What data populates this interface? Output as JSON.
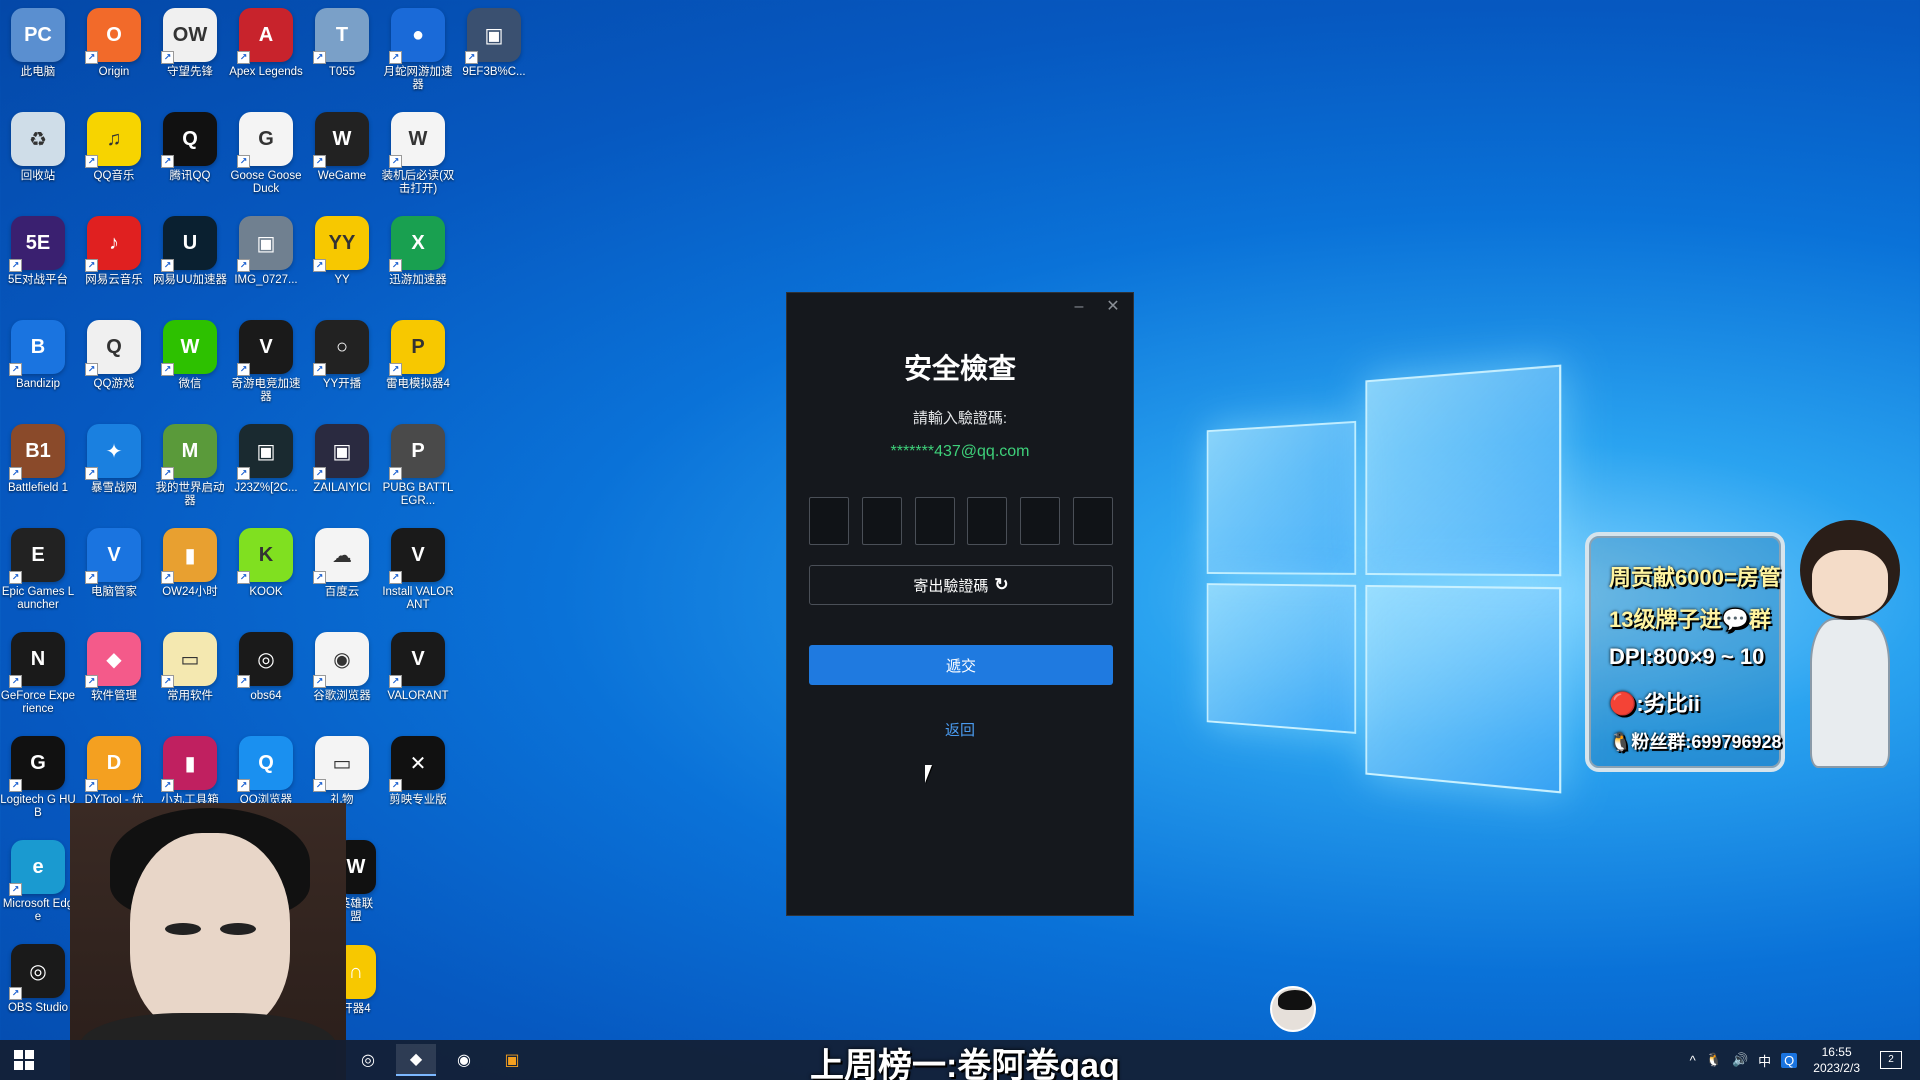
{
  "desktop": {
    "icons": [
      {
        "label": "此电脑",
        "color": "#5a8fd0",
        "glyph": "PC"
      },
      {
        "label": "Origin",
        "color": "#f26a2a",
        "glyph": "O"
      },
      {
        "label": "守望先锋",
        "color": "#f0f0f0",
        "glyph": "OW"
      },
      {
        "label": "Apex Legends",
        "color": "#c8232c",
        "glyph": "A"
      },
      {
        "label": "T055",
        "color": "#7aa0c8",
        "glyph": "T"
      },
      {
        "label": "月蛇网游加速器",
        "color": "#1a6ad8",
        "glyph": "●"
      },
      {
        "label": "9EF3B%C...",
        "color": "#3a5070",
        "glyph": "▣"
      },
      {
        "label": "回收站",
        "color": "#cfdde8",
        "glyph": "♻"
      },
      {
        "label": "QQ音乐",
        "color": "#f7d400",
        "glyph": "♫"
      },
      {
        "label": "腾讯QQ",
        "color": "#111111",
        "glyph": "Q"
      },
      {
        "label": "Goose Goose Duck",
        "color": "#f4f4f4",
        "glyph": "G"
      },
      {
        "label": "WeGame",
        "color": "#222222",
        "glyph": "W"
      },
      {
        "label": "装机后必读(双击打开)",
        "color": "#f4f4f4",
        "glyph": "W"
      },
      {
        "label": "5E对战平台",
        "color": "#3a2070",
        "glyph": "5E"
      },
      {
        "label": "网易云音乐",
        "color": "#e02020",
        "glyph": "♪"
      },
      {
        "label": "网易UU加速器",
        "color": "#0a2030",
        "glyph": "U"
      },
      {
        "label": "IMG_0727...",
        "color": "#708090",
        "glyph": "▣"
      },
      {
        "label": "YY",
        "color": "#f7c800",
        "glyph": "YY"
      },
      {
        "label": "迅游加速器",
        "color": "#19a050",
        "glyph": "X"
      },
      {
        "label": "Bandizip",
        "color": "#1a74e0",
        "glyph": "B"
      },
      {
        "label": "QQ游戏",
        "color": "#f0f0f0",
        "glyph": "Q"
      },
      {
        "label": "微信",
        "color": "#2dc100",
        "glyph": "W"
      },
      {
        "label": "奇游电竞加速器",
        "color": "#1a1a1a",
        "glyph": "V"
      },
      {
        "label": "YY开播",
        "color": "#222222",
        "glyph": "○"
      },
      {
        "label": "雷电模拟器4",
        "color": "#f7c800",
        "glyph": "P"
      },
      {
        "label": "Battlefield 1",
        "color": "#8a4a2a",
        "glyph": "B1"
      },
      {
        "label": "暴雪战网",
        "color": "#1a80e0",
        "glyph": "✦"
      },
      {
        "label": "我的世界启动器",
        "color": "#5a9a3a",
        "glyph": "M"
      },
      {
        "label": "J23Z%[2C...",
        "color": "#1a2a30",
        "glyph": "▣"
      },
      {
        "label": "ZAILAIYICI",
        "color": "#2a2a40",
        "glyph": "▣"
      },
      {
        "label": "PUBG BATTLEGR...",
        "color": "#4a4a4a",
        "glyph": "P"
      },
      {
        "label": "Epic Games Launcher",
        "color": "#222222",
        "glyph": "E"
      },
      {
        "label": "电脑管家",
        "color": "#1a74e0",
        "glyph": "V"
      },
      {
        "label": "OW24小时",
        "color": "#e8a030",
        "glyph": "▮"
      },
      {
        "label": "KOOK",
        "color": "#80e020",
        "glyph": "K"
      },
      {
        "label": "百度云",
        "color": "#f4f4f4",
        "glyph": "☁"
      },
      {
        "label": "Install VALORANT",
        "color": "#1a1a1a",
        "glyph": "V"
      },
      {
        "label": "GeForce Experience",
        "color": "#1a1a1a",
        "glyph": "N"
      },
      {
        "label": "软件管理",
        "color": "#f45a8a",
        "glyph": "◆"
      },
      {
        "label": "常用软件",
        "color": "#f4e8b0",
        "glyph": "▭"
      },
      {
        "label": "obs64",
        "color": "#1a1a1a",
        "glyph": "◎"
      },
      {
        "label": "谷歌浏览器",
        "color": "#f4f4f4",
        "glyph": "◉"
      },
      {
        "label": "VALORANT",
        "color": "#1a1a1a",
        "glyph": "V"
      },
      {
        "label": "Logitech G HUB",
        "color": "#111111",
        "glyph": "G"
      },
      {
        "label": "DYTool - 优",
        "color": "#f4a020",
        "glyph": "D"
      },
      {
        "label": "小丸工具箱",
        "color": "#c02060",
        "glyph": "▮"
      },
      {
        "label": "QQ浏览器",
        "color": "#1a90f0",
        "glyph": "Q"
      },
      {
        "label": "礼物",
        "color": "#f4f4f4",
        "glyph": "▭"
      },
      {
        "label": "剪映专业版",
        "color": "#111111",
        "glyph": "✕"
      },
      {
        "label": "Microsoft Edge",
        "color": "#1a9ad0",
        "glyph": "e"
      },
      {
        "label": "OBS Studio",
        "color": "#1a1a1a",
        "glyph": "◎"
      }
    ],
    "partial_labels": [
      {
        "label": "英雄联盟",
        "color": "#111111",
        "glyph": "W"
      },
      {
        "label": "开器4",
        "color": "#f7c800",
        "glyph": "∩"
      }
    ]
  },
  "dialog": {
    "minimize_glyph": "–",
    "close_glyph": "✕",
    "title": "安全檢查",
    "prompt": "請輸入驗證碼:",
    "email": "*******437@qq.com",
    "code_boxes": [
      "",
      "",
      "",
      "",
      "",
      ""
    ],
    "send_button": "寄出驗證碼",
    "refresh_glyph": "↻",
    "submit_button": "遞交",
    "back_link": "返回"
  },
  "overlay": {
    "line1": "周贡献6000=房管",
    "line2": "13级牌子进💬群",
    "line3": "DPI:800×9 ~ 10",
    "line4": "🔴:劣比ii",
    "line5": "🐧粉丝群:699796928"
  },
  "caption": "上周榜一:卷阿卷qaq",
  "taskbar": {
    "apps": [
      {
        "glyph": "◎",
        "name": "uu-booster"
      },
      {
        "glyph": "◆",
        "name": "browser"
      },
      {
        "glyph": "◉",
        "name": "obs"
      },
      {
        "glyph": "▣",
        "name": "app"
      }
    ],
    "tray": {
      "chevron": "^",
      "qq": "🐧",
      "volume": "🔊",
      "ime": "中",
      "app": "Q",
      "time": "16:55",
      "date": "2023/2/3",
      "notifications": "2"
    }
  }
}
